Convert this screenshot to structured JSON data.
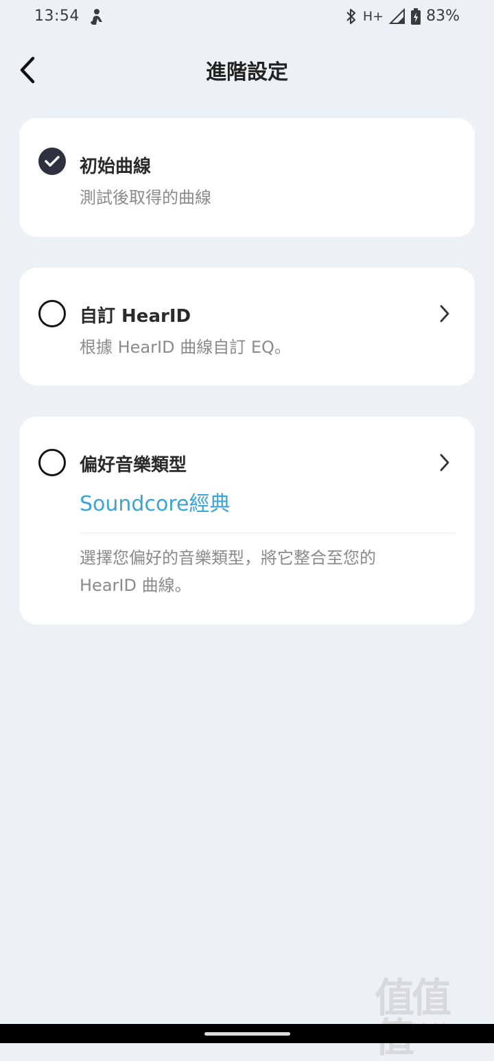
{
  "status_bar": {
    "time": "13:54",
    "network": "H+",
    "battery": "83%",
    "icons": [
      "person-icon",
      "bluetooth-icon",
      "signal-icon",
      "battery-icon"
    ]
  },
  "header": {
    "title": "進階設定",
    "back_icon": "chevron-left-icon"
  },
  "options": [
    {
      "title": "初始曲線",
      "subtitle": "測試後取得的曲線",
      "selected": true
    },
    {
      "title": "自訂 HearID",
      "subtitle": "根據 HearID 曲線自訂 EQ。",
      "selected": false
    },
    {
      "title": "偏好音樂類型",
      "value": "Soundcore經典",
      "description": "選擇您偏好的音樂類型，將它整合至您的 HearID 曲線。",
      "selected": false
    }
  ],
  "watermark": {
    "glyphs": "值值值",
    "url": "zhizhizhi.com"
  },
  "colors": {
    "background": "#ecf1f5",
    "card": "#ffffff",
    "accent": "#3aa4d6",
    "checked": "#2e3140"
  }
}
